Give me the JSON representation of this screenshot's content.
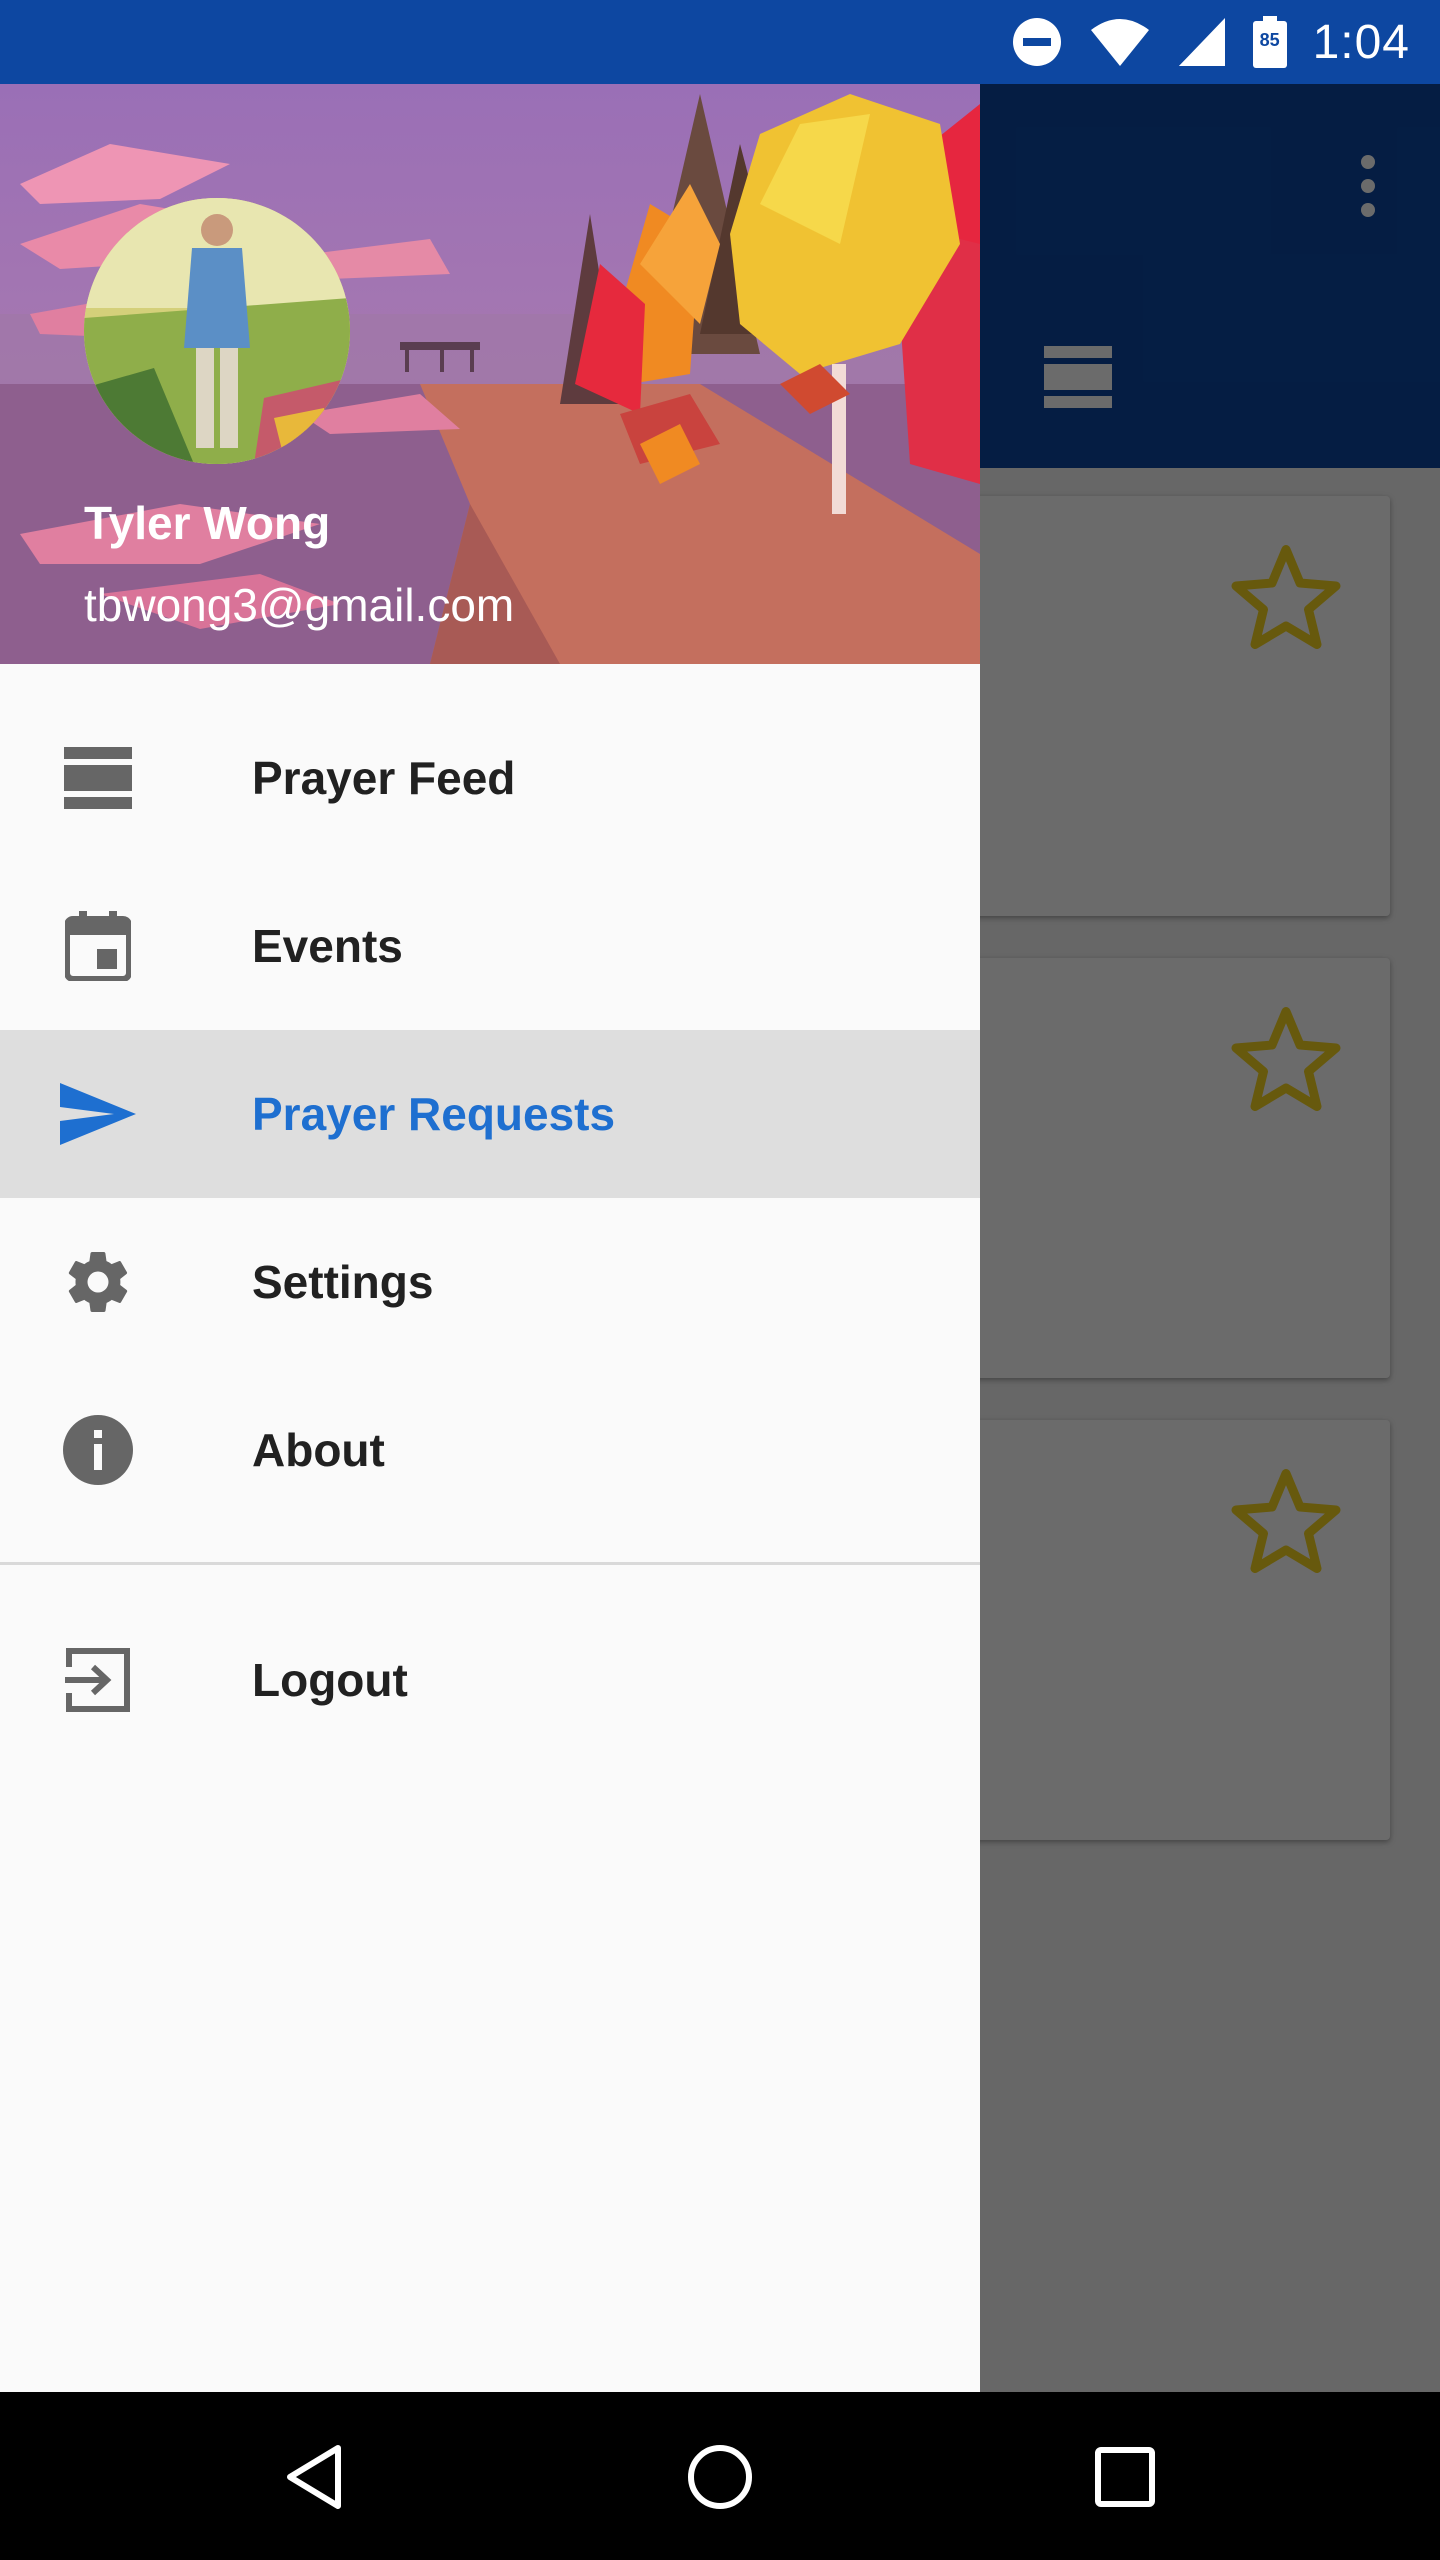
{
  "status_bar": {
    "time": "1:04",
    "battery_level": "85",
    "icons": [
      "do-not-disturb-icon",
      "wifi-icon",
      "cell-signal-icon",
      "battery-icon"
    ]
  },
  "app": {
    "toolbar_color": "#0d47a1",
    "cards": [
      "card-1",
      "card-2",
      "card-3"
    ]
  },
  "drawer": {
    "user": {
      "name": "Tyler Wong",
      "email": "tbwong3@gmail.com"
    },
    "menu": [
      {
        "label": "Prayer Feed",
        "icon": "feed-icon",
        "active": false
      },
      {
        "label": "Events",
        "icon": "calendar-icon",
        "active": false
      },
      {
        "label": "Prayer Requests",
        "icon": "send-icon",
        "active": true
      },
      {
        "label": "Settings",
        "icon": "gear-icon",
        "active": false
      },
      {
        "label": "About",
        "icon": "info-icon",
        "active": false
      }
    ],
    "secondary_menu": [
      {
        "label": "Logout",
        "icon": "logout-icon"
      }
    ],
    "active_color": "#1e6fd0"
  },
  "nav_bar": {
    "buttons": [
      "back-icon",
      "home-icon",
      "recents-icon"
    ]
  }
}
